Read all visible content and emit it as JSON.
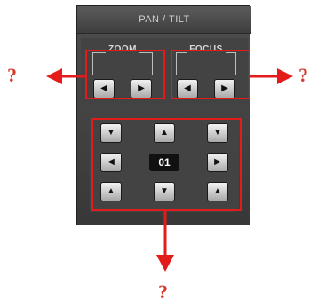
{
  "panel": {
    "title": "PAN / TILT",
    "zoom": {
      "legend": "ZOOM",
      "left_icon": "◀",
      "right_icon": "▶"
    },
    "focus": {
      "legend": "FOCUS",
      "left_icon": "◀",
      "right_icon": "▶"
    },
    "ptz": {
      "up_left_icon": "▼",
      "up_icon": "▲",
      "up_right_icon": "▼",
      "left_icon": "◀",
      "preset": "01",
      "right_icon": "▶",
      "down_left_icon": "▲",
      "down_icon": "▼",
      "down_right_icon": "▲"
    }
  },
  "annotations": {
    "q_left": "?",
    "q_right": "?",
    "q_bottom": "?"
  },
  "colors": {
    "highlight": "#e31b1b",
    "arrow": "#e31b1b",
    "question": "#d63b2f"
  }
}
